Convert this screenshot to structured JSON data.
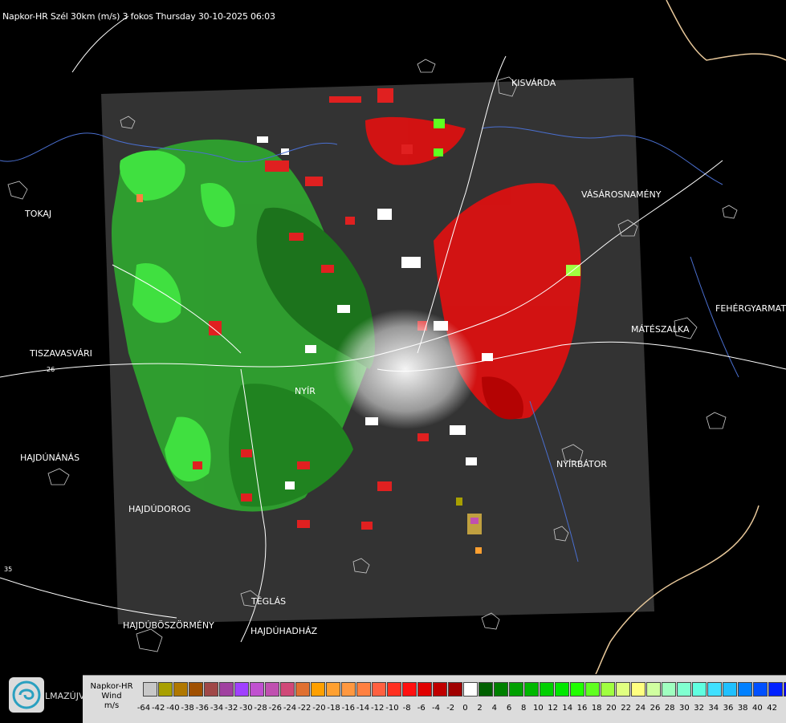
{
  "title": "Napkor-HR Szél 30km (m/s) 3 fokos Thursday 30-10-2025 06:03",
  "cities": [
    {
      "name": "KISVÁRDA"
    },
    {
      "name": "VÁSÁROSNAMÉNY"
    },
    {
      "name": "TOKAJ"
    },
    {
      "name": "FEHÉRGYARMAT"
    },
    {
      "name": "MÁTÉSZALKA"
    },
    {
      "name": "TISZAVASVÁRI"
    },
    {
      "name": "NYÍR"
    },
    {
      "name": "HAJDÚNÁNÁS"
    },
    {
      "name": "NYÍRBÁTOR"
    },
    {
      "name": "HAJDÚDOROG"
    },
    {
      "name": "TÉGLÁS"
    },
    {
      "name": "HAJDÚBÖSZÖRMÉNY"
    },
    {
      "name": "HAJDÚHADHÁZ"
    }
  ],
  "road_labels": [
    "26",
    "35"
  ],
  "logo_text": "LMAZÚJVÁR",
  "legend": {
    "label_line1": "Napkor-HR",
    "label_line2": "Wind",
    "label_line3": "m/s",
    "ticks": [
      "-64",
      "-42",
      "-40",
      "-38",
      "-36",
      "-34",
      "-32",
      "-30",
      "-28",
      "-26",
      "-24",
      "-22",
      "-20",
      "-18",
      "-16",
      "-14",
      "-12",
      "-10",
      "-8",
      "-6",
      "-4",
      "-2",
      "0",
      "2",
      "4",
      "6",
      "8",
      "10",
      "12",
      "14",
      "16",
      "18",
      "20",
      "22",
      "24",
      "26",
      "28",
      "30",
      "32",
      "34",
      "36",
      "38",
      "40",
      "42"
    ],
    "colors": [
      "#c8c8c8",
      "#a8a000",
      "#b07800",
      "#a05000",
      "#a04848",
      "#a040a0",
      "#a040ff",
      "#c050d0",
      "#c050b0",
      "#d04878",
      "#e07030",
      "#ffa000",
      "#ffa030",
      "#ff9840",
      "#ff8040",
      "#ff6040",
      "#ff3020",
      "#ff1010",
      "#e00000",
      "#c00000",
      "#a00000",
      "#ffffff",
      "#006000",
      "#008000",
      "#00a000",
      "#00b800",
      "#00d000",
      "#00e800",
      "#20ff00",
      "#60ff20",
      "#a0ff40",
      "#e0ff80",
      "#ffff80",
      "#d0ffa0",
      "#a0ffc0",
      "#80ffd0",
      "#60ffe0",
      "#40e0ff",
      "#20c0ff",
      "#0080ff",
      "#0050ff",
      "#0020ff",
      "#0000ff"
    ]
  }
}
